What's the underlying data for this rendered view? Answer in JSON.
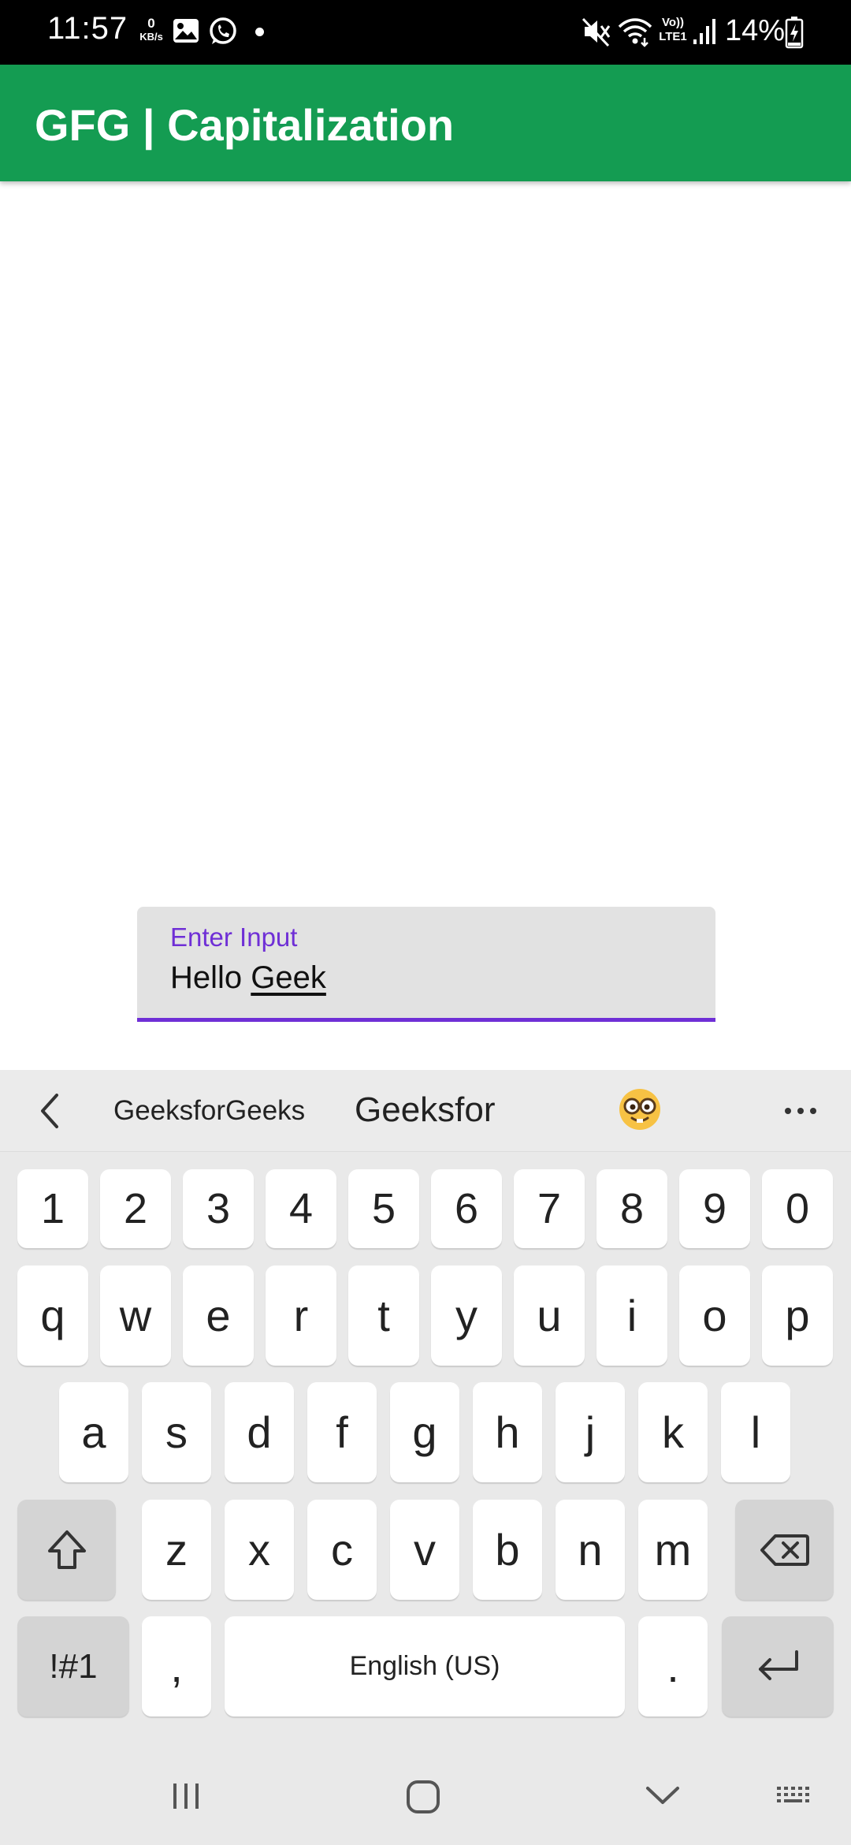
{
  "status_bar": {
    "time": "11:57",
    "net_speed_value": "0",
    "net_speed_unit": "KB/s",
    "volte_top": "Vo))",
    "volte_bottom": "LTE1",
    "battery": "14%",
    "icons": [
      "gallery-icon",
      "whatsapp-icon",
      "notification-dot-icon",
      "mute-icon",
      "wifi-icon",
      "signal-icon",
      "battery-charging-icon"
    ]
  },
  "app_bar": {
    "title": "GFG | Capitalization",
    "color": "#149c52"
  },
  "text_field": {
    "label": "Enter Input",
    "value_plain": "Hello ",
    "value_composing": "Geek",
    "accent_color": "#6f2fd6"
  },
  "keyboard": {
    "suggestions": [
      "GeeksforGeeks",
      "Geeksfor"
    ],
    "suggestion_icons": [
      "back-arrow-icon",
      "nerd-face-emoji-icon",
      "more-options-icon"
    ],
    "number_row": [
      "1",
      "2",
      "3",
      "4",
      "5",
      "6",
      "7",
      "8",
      "9",
      "0"
    ],
    "row1": [
      "q",
      "w",
      "e",
      "r",
      "t",
      "y",
      "u",
      "i",
      "o",
      "p"
    ],
    "row2": [
      "a",
      "s",
      "d",
      "f",
      "g",
      "h",
      "j",
      "k",
      "l"
    ],
    "row3": [
      "z",
      "x",
      "c",
      "v",
      "b",
      "n",
      "m"
    ],
    "symbols_label": "!#1",
    "comma_label": ",",
    "space_label": "English (US)",
    "period_label": ".",
    "special_icons": [
      "shift-icon",
      "backspace-icon",
      "enter-icon"
    ]
  },
  "nav_bar": {
    "icons": [
      "recents-icon",
      "home-icon",
      "back-icon",
      "keyboard-switch-icon"
    ]
  }
}
